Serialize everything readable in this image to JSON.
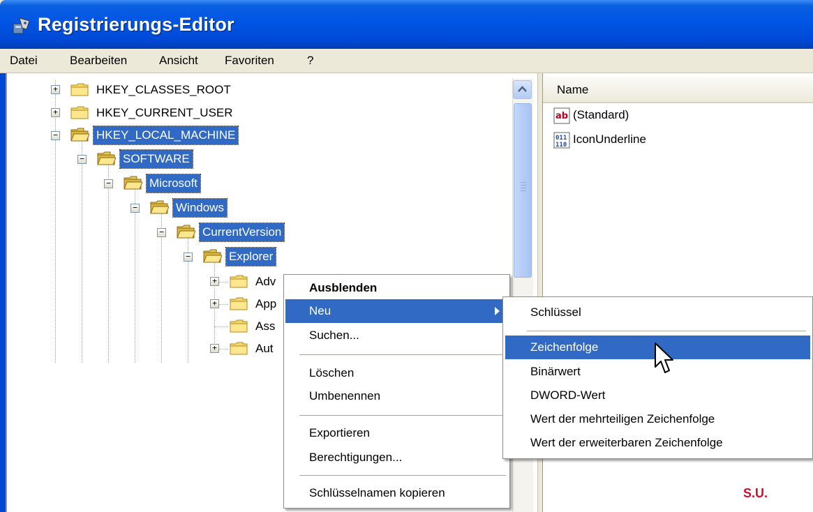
{
  "window": {
    "title": "Registrierungs-Editor"
  },
  "menubar": {
    "items": [
      "Datei",
      "Bearbeiten",
      "Ansicht",
      "Favoriten",
      "?"
    ]
  },
  "tree": {
    "nodes": [
      {
        "label": "HKEY_CLASSES_ROOT",
        "expander": "+",
        "selected": false
      },
      {
        "label": "HKEY_CURRENT_USER",
        "expander": "+",
        "selected": false
      },
      {
        "label": "HKEY_LOCAL_MACHINE",
        "expander": "−",
        "selected": true
      },
      {
        "label": "SOFTWARE",
        "expander": "−",
        "selected": true
      },
      {
        "label": "Microsoft",
        "expander": "−",
        "selected": true
      },
      {
        "label": "Windows",
        "expander": "−",
        "selected": true
      },
      {
        "label": "CurrentVersion",
        "expander": "−",
        "selected": true
      },
      {
        "label": "Explorer",
        "expander": "−",
        "selected": true
      },
      {
        "label": "Adv",
        "expander": "+",
        "selected": false
      },
      {
        "label": "App",
        "expander": "+",
        "selected": false
      },
      {
        "label": "Ass",
        "expander": "",
        "selected": false
      },
      {
        "label": "Aut",
        "expander": "+",
        "selected": false
      }
    ]
  },
  "list": {
    "column_name": "Name",
    "entries": [
      {
        "icon": "string-value-icon",
        "label": "(Standard)"
      },
      {
        "icon": "binary-value-icon",
        "label": "IconUnderline"
      }
    ]
  },
  "context_menu": {
    "items": [
      {
        "label": "Ausblenden",
        "bold": true,
        "highlighted": false
      },
      {
        "label": "Neu",
        "bold": false,
        "highlighted": true,
        "submenu": true
      },
      {
        "label": "Suchen...",
        "bold": false,
        "highlighted": false
      },
      {
        "label": "Löschen",
        "bold": false,
        "highlighted": false
      },
      {
        "label": "Umbenennen",
        "bold": false,
        "highlighted": false
      },
      {
        "label": "Exportieren",
        "bold": false,
        "highlighted": false
      },
      {
        "label": "Berechtigungen...",
        "bold": false,
        "highlighted": false
      },
      {
        "label": "Schlüsselnamen kopieren",
        "bold": false,
        "highlighted": false
      }
    ]
  },
  "submenu": {
    "items": [
      {
        "label": "Schlüssel",
        "highlighted": false
      },
      {
        "label": "Zeichenfolge",
        "highlighted": true
      },
      {
        "label": "Binärwert",
        "highlighted": false
      },
      {
        "label": "DWORD-Wert",
        "highlighted": false
      },
      {
        "label": "Wert der mehrteiligen Zeichenfolge",
        "highlighted": false
      },
      {
        "label": "Wert der erweiterbaren Zeichenfolge",
        "highlighted": false
      }
    ]
  },
  "signature": "S.U.",
  "colors": {
    "titlebar": "#0055e5",
    "selection": "#316ac5",
    "signature": "#c8102e"
  }
}
